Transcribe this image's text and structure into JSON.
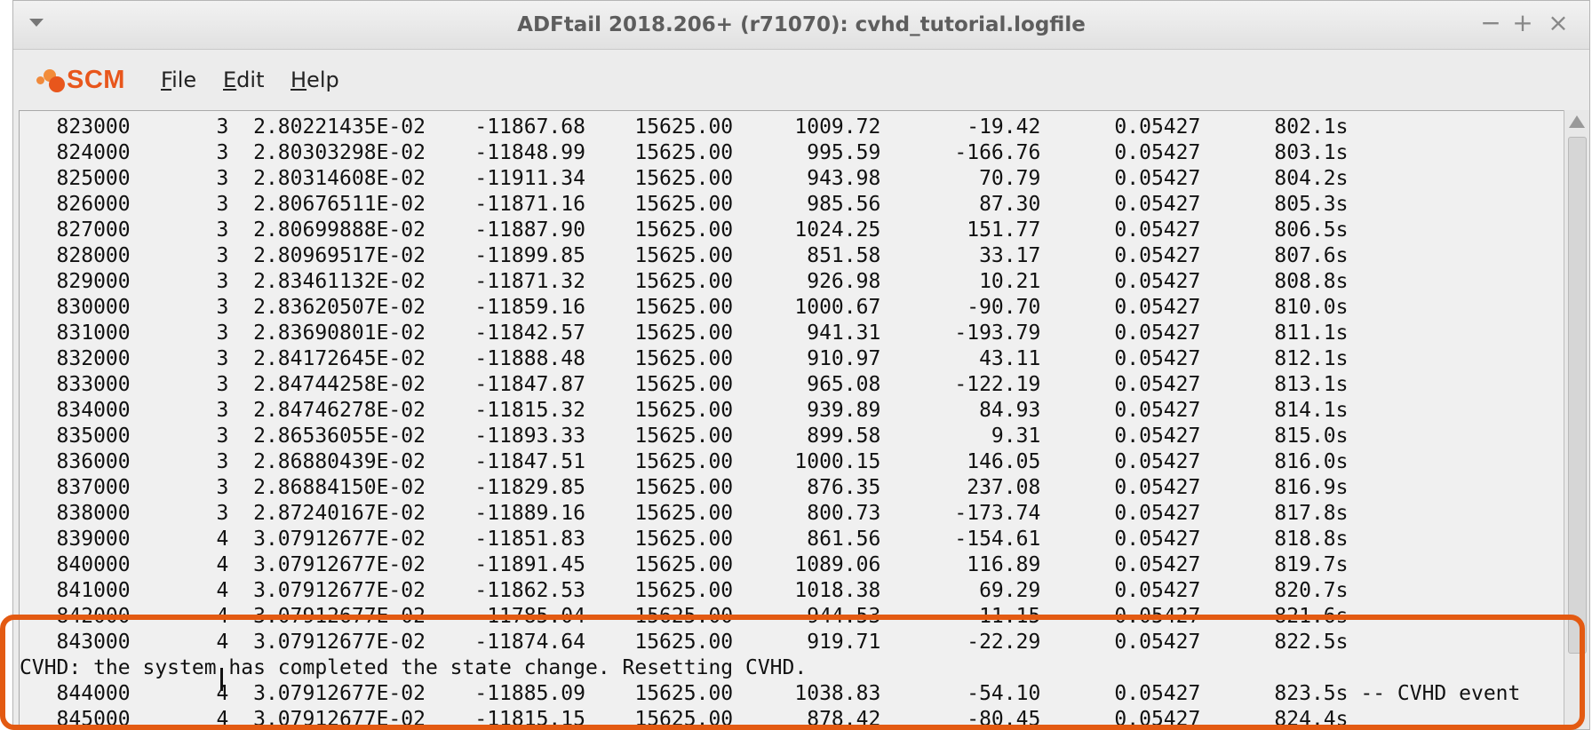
{
  "window": {
    "title": "ADFtail 2018.206+ (r71070): cvhd_tutorial.logfile",
    "controls": {
      "minimize": "−",
      "maximize": "+",
      "close": "×"
    }
  },
  "logo": {
    "text": "SCM"
  },
  "menu": {
    "file": "File",
    "edit": "Edit",
    "help": "Help"
  },
  "log_lines": [
    "   823000       3  2.80221435E-02    -11867.68    15625.00     1009.72       -19.42      0.05427      802.1s",
    "   824000       3  2.80303298E-02    -11848.99    15625.00      995.59      -166.76      0.05427      803.1s",
    "   825000       3  2.80314608E-02    -11911.34    15625.00      943.98        70.79      0.05427      804.2s",
    "   826000       3  2.80676511E-02    -11871.16    15625.00      985.56        87.30      0.05427      805.3s",
    "   827000       3  2.80699888E-02    -11887.90    15625.00     1024.25       151.77      0.05427      806.5s",
    "   828000       3  2.80969517E-02    -11899.85    15625.00      851.58        33.17      0.05427      807.6s",
    "   829000       3  2.83461132E-02    -11871.32    15625.00      926.98        10.21      0.05427      808.8s",
    "   830000       3  2.83620507E-02    -11859.16    15625.00     1000.67       -90.70      0.05427      810.0s",
    "   831000       3  2.83690801E-02    -11842.57    15625.00      941.31      -193.79      0.05427      811.1s",
    "   832000       3  2.84172645E-02    -11888.48    15625.00      910.97        43.11      0.05427      812.1s",
    "   833000       3  2.84744258E-02    -11847.87    15625.00      965.08      -122.19      0.05427      813.1s",
    "   834000       3  2.84746278E-02    -11815.32    15625.00      939.89        84.93      0.05427      814.1s",
    "   835000       3  2.86536055E-02    -11893.33    15625.00      899.58         9.31      0.05427      815.0s",
    "   836000       3  2.86880439E-02    -11847.51    15625.00     1000.15       146.05      0.05427      816.0s",
    "   837000       3  2.86884150E-02    -11829.85    15625.00      876.35       237.08      0.05427      816.9s",
    "   838000       3  2.87240167E-02    -11889.16    15625.00      800.73      -173.74      0.05427      817.8s",
    "   839000       4  3.07912677E-02    -11851.83    15625.00      861.56      -154.61      0.05427      818.8s",
    "   840000       4  3.07912677E-02    -11891.45    15625.00     1089.06       116.89      0.05427      819.7s",
    "   841000       4  3.07912677E-02    -11862.53    15625.00     1018.38        69.29      0.05427      820.7s",
    "   842000       4  3.07912677E-02    -11785.04    15625.00      944.53        11.15      0.05427      821.6s",
    "   843000       4  3.07912677E-02    -11874.64    15625.00      919.71       -22.29      0.05427      822.5s",
    "CVHD: the system has completed the state change. Resetting CVHD.",
    "   844000       4  3.07912677E-02    -11885.09    15625.00     1038.83       -54.10      0.05427      823.5s -- CVHD event",
    "   845000       4  3.07912677E-02    -11815.15    15625.00      878.42       -80.45      0.05427      824.4s"
  ],
  "colors": {
    "highlight": "#e35a12",
    "logo": "#e8561c"
  }
}
